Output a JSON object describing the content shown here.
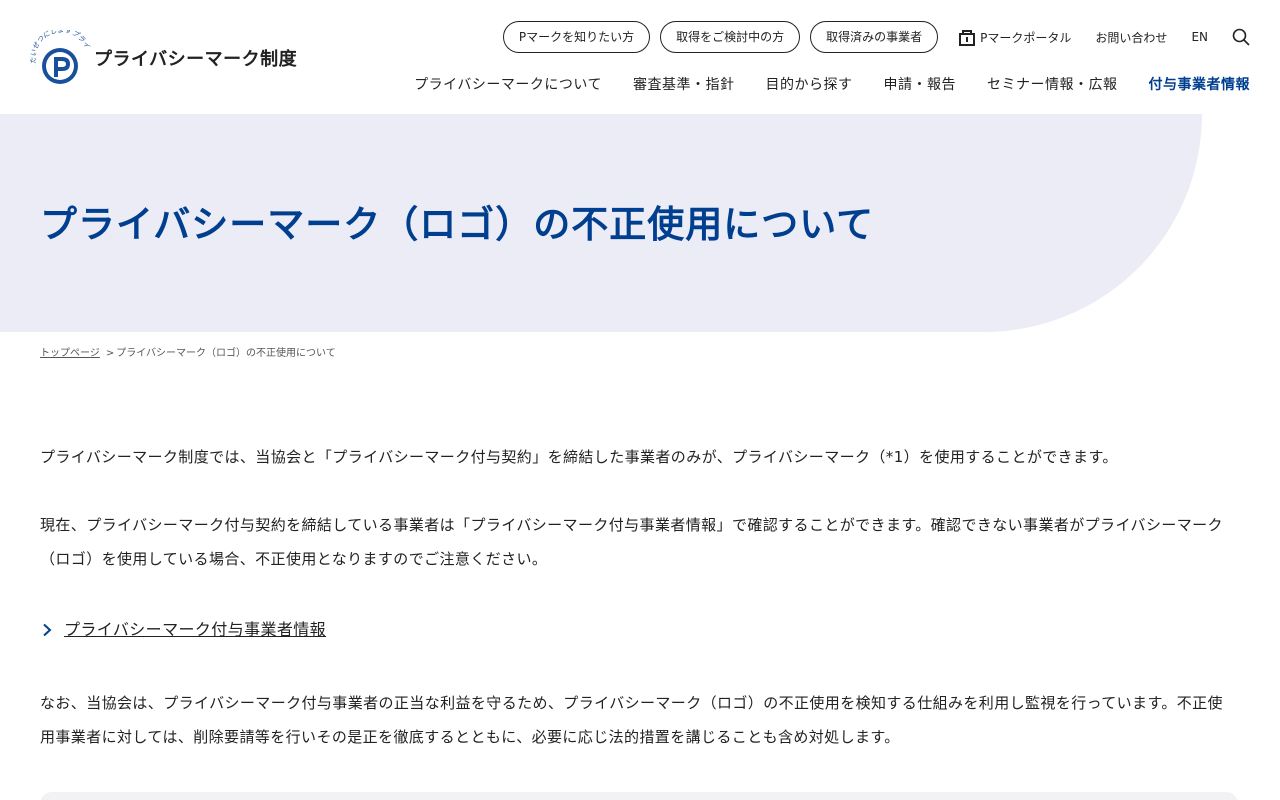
{
  "header": {
    "logo_text": "プライバシーマーク制度",
    "logo_arc_text": "たいせつにしますプライバシー",
    "top_links": [
      "Pマークを知りたい方",
      "取得をご検討中の方",
      "取得済みの事業者"
    ],
    "portal_label": "Pマークポータル",
    "contact_label": "お問い合わせ",
    "lang_label": "EN",
    "nav": [
      "プライバシーマークについて",
      "審査基準・指針",
      "目的から探す",
      "申請・報告",
      "セミナー情報・広報",
      "付与事業者情報"
    ]
  },
  "hero": {
    "title": "プライバシーマーク（ロゴ）の不正使用について"
  },
  "breadcrumb": {
    "home": "トップページ",
    "separator": ">",
    "current": "プライバシーマーク（ロゴ）の不正使用について"
  },
  "content": {
    "p1": "プライバシーマーク制度では、当協会と「プライバシーマーク付与契約」を締結した事業者のみが、プライバシーマーク（*1）を使用することができます。",
    "p2": "現在、プライバシーマーク付与契約を締結している事業者は「プライバシーマーク付与事業者情報」で確認することができます。確認できない事業者がプライバシーマーク（ロゴ）を使用している場合、不正使用となりますのでご注意ください。",
    "link": "プライバシーマーク付与事業者情報",
    "p3": "なお、当協会は、プライバシーマーク付与事業者の正当な利益を守るため、プライバシーマーク（ロゴ）の不正使用を検知する仕組みを利用し監視を行っています。不正使用事業者に対しては、削除要請等を行いその是正を徹底するとともに、必要に応じ法的措置を講じることも含め対処します。"
  },
  "colors": {
    "brand_blue": "#003f8f",
    "hero_bg": "#ebecf5"
  }
}
